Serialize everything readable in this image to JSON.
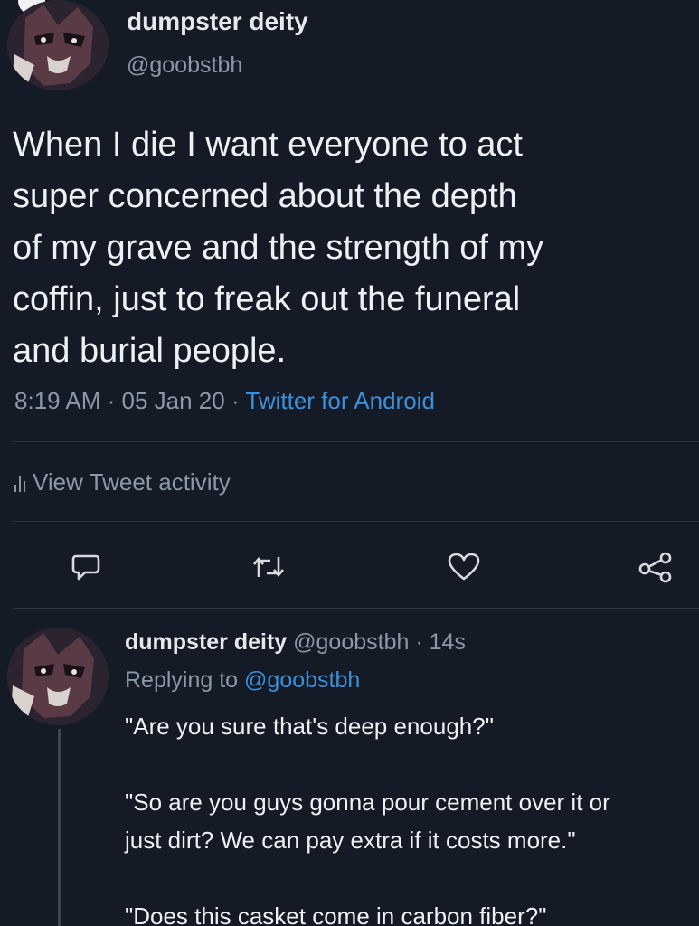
{
  "tweet": {
    "author_name": "dumpster deity",
    "author_handle": "@goobstbh",
    "text": "When I die I want everyone to act\nsuper concerned about the depth\nof my grave and the strength of my\ncoffin, just to freak out the funeral\nand burial people.",
    "time": "8:19 AM",
    "sep1": " · ",
    "date": "05 Jan 20",
    "sep2": " · ",
    "source": "Twitter for Android",
    "activity_label": "View Tweet activity"
  },
  "reply": {
    "author_name": "dumpster deity",
    "author_handle": " @goobstbh",
    "time": " · 14s",
    "replying_prefix": "Replying to ",
    "replying_to": "@goobstbh",
    "text": "\"Are you sure that's deep enough?\"\n\n\"So are you guys gonna pour cement over it or\njust dirt? We can pay extra if it costs more.\"\n\n\"Does this casket come in carbon fiber?\""
  },
  "icons": {
    "reply": "speech-bubble-icon",
    "retweet": "retweet-icon",
    "like": "heart-icon",
    "share": "share-icon",
    "activity": "bar-chart-icon"
  },
  "colors": {
    "background": "#141b26",
    "text": "#eef1f3",
    "secondary": "#8b98a5",
    "link": "#3d8fd8"
  }
}
